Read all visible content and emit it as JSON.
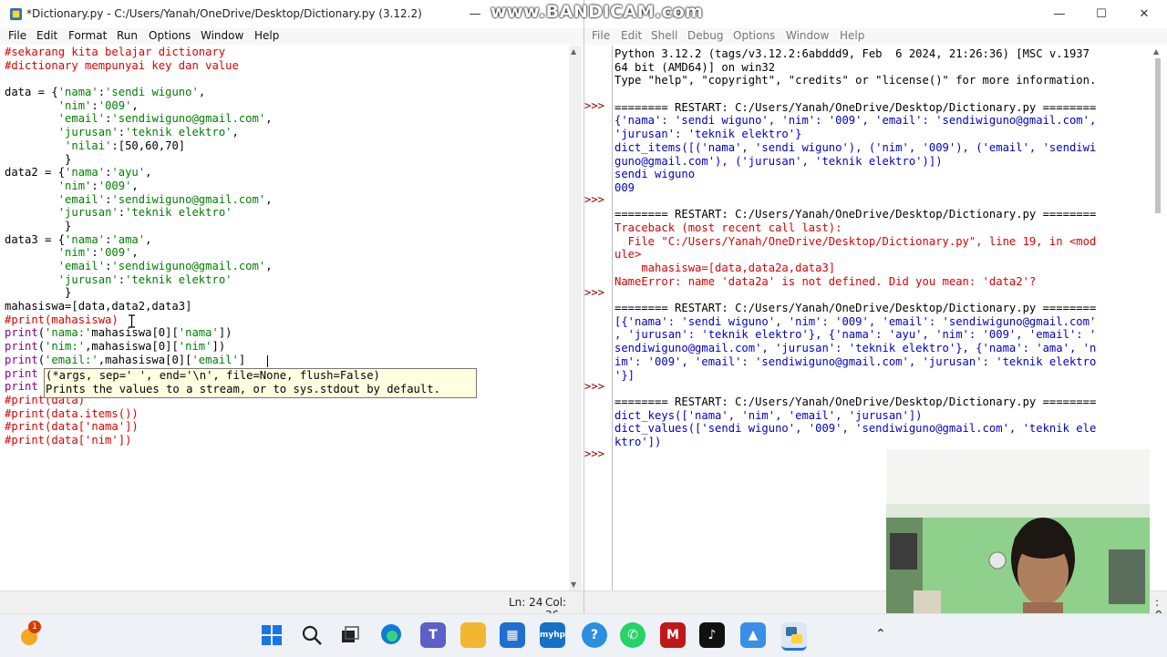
{
  "left_window": {
    "title": "*Dictionary.py - C:/Users/Yanah/OneDrive/Desktop/Dictionary.py (3.12.2)",
    "menu": [
      "File",
      "Edit",
      "Format",
      "Run",
      "Options",
      "Window",
      "Help"
    ],
    "status": {
      "line": "Ln: 24",
      "col": "Col: 36"
    },
    "code": [
      [
        {
          "c": "cm",
          "t": "#sekarang kita belajar dictionary"
        }
      ],
      [
        {
          "c": "cm",
          "t": "#dictionary mempunyai key dan value"
        }
      ],
      [
        {
          "t": ""
        }
      ],
      [
        {
          "t": "data = {"
        },
        {
          "c": "st",
          "t": "'nama'"
        },
        {
          "t": ":"
        },
        {
          "c": "st",
          "t": "'sendi wiguno'"
        },
        {
          "t": ","
        }
      ],
      [
        {
          "t": "        "
        },
        {
          "c": "st",
          "t": "'nim'"
        },
        {
          "t": ":"
        },
        {
          "c": "st",
          "t": "'009'"
        },
        {
          "t": ","
        }
      ],
      [
        {
          "t": "        "
        },
        {
          "c": "st",
          "t": "'email'"
        },
        {
          "t": ":"
        },
        {
          "c": "st",
          "t": "'sendiwiguno@gmail.com'"
        },
        {
          "t": ","
        }
      ],
      [
        {
          "t": "        "
        },
        {
          "c": "st",
          "t": "'jurusan'"
        },
        {
          "t": ":"
        },
        {
          "c": "st",
          "t": "'teknik elektro'"
        },
        {
          "t": ","
        }
      ],
      [
        {
          "t": "         "
        },
        {
          "c": "st",
          "t": "'nilai'"
        },
        {
          "t": ":[50,60,70]"
        }
      ],
      [
        {
          "t": "         }"
        }
      ],
      [
        {
          "t": "data2 = {"
        },
        {
          "c": "st",
          "t": "'nama'"
        },
        {
          "t": ":"
        },
        {
          "c": "st",
          "t": "'ayu'"
        },
        {
          "t": ","
        }
      ],
      [
        {
          "t": "        "
        },
        {
          "c": "st",
          "t": "'nim'"
        },
        {
          "t": ":"
        },
        {
          "c": "st",
          "t": "'009'"
        },
        {
          "t": ","
        }
      ],
      [
        {
          "t": "        "
        },
        {
          "c": "st",
          "t": "'email'"
        },
        {
          "t": ":"
        },
        {
          "c": "st",
          "t": "'sendiwiguno@gmail.com'"
        },
        {
          "t": ","
        }
      ],
      [
        {
          "t": "        "
        },
        {
          "c": "st",
          "t": "'jurusan'"
        },
        {
          "t": ":"
        },
        {
          "c": "st",
          "t": "'teknik elektro'"
        }
      ],
      [
        {
          "t": "         }"
        }
      ],
      [
        {
          "t": "data3 = {"
        },
        {
          "c": "st",
          "t": "'nama'"
        },
        {
          "t": ":"
        },
        {
          "c": "st",
          "t": "'ama'"
        },
        {
          "t": ","
        }
      ],
      [
        {
          "t": "        "
        },
        {
          "c": "st",
          "t": "'nim'"
        },
        {
          "t": ":"
        },
        {
          "c": "st",
          "t": "'009'"
        },
        {
          "t": ","
        }
      ],
      [
        {
          "t": "        "
        },
        {
          "c": "st",
          "t": "'email'"
        },
        {
          "t": ":"
        },
        {
          "c": "st",
          "t": "'sendiwiguno@gmail.com'"
        },
        {
          "t": ","
        }
      ],
      [
        {
          "t": "        "
        },
        {
          "c": "st",
          "t": "'jurusan'"
        },
        {
          "t": ":"
        },
        {
          "c": "st",
          "t": "'teknik elektro'"
        }
      ],
      [
        {
          "t": "         }"
        }
      ],
      [
        {
          "t": "mahasiswa=[data,data2,data3]"
        }
      ],
      [
        {
          "c": "cm",
          "t": "#print(mahasiswa)"
        }
      ],
      [
        {
          "c": "kw",
          "t": "print"
        },
        {
          "t": "("
        },
        {
          "c": "st",
          "t": "'nama:'"
        },
        {
          "t": "mahasiswa[0]["
        },
        {
          "c": "st",
          "t": "'nama'"
        },
        {
          "t": "])"
        }
      ],
      [
        {
          "c": "kw",
          "t": "print"
        },
        {
          "t": "("
        },
        {
          "c": "st",
          "t": "'nim:'"
        },
        {
          "t": ",mahasiswa[0]["
        },
        {
          "c": "st",
          "t": "'nim'"
        },
        {
          "t": "])"
        }
      ],
      [
        {
          "c": "kw",
          "t": "print"
        },
        {
          "t": "("
        },
        {
          "c": "st",
          "t": "'email:'"
        },
        {
          "t": ",mahasiswa[0]["
        },
        {
          "c": "st",
          "t": "'email'"
        },
        {
          "t": "]"
        }
      ],
      [
        {
          "c": "kw",
          "t": "print"
        }
      ],
      [
        {
          "c": "kw",
          "t": "print"
        }
      ],
      [
        {
          "c": "cm",
          "t": "#print(data)"
        }
      ],
      [
        {
          "c": "cm",
          "t": "#print(data.items())"
        }
      ],
      [
        {
          "c": "cm",
          "t": "#print(data['nama'])"
        }
      ],
      [
        {
          "c": "cm",
          "t": "#print(data['nim'])"
        }
      ]
    ],
    "tooltip": {
      "line1": "(*args, sep=' ', end='\\n', file=None, flush=False)",
      "line2": "Prints the values to a stream, or to sys.stdout by default."
    }
  },
  "right_window": {
    "title_tail": "2.2",
    "menu": [
      "File",
      "Edit",
      "Shell",
      "Debug",
      "Options",
      "Window",
      "Help"
    ],
    "status_tail": ": 0",
    "shell": [
      {
        "c": "",
        "t": "Python 3.12.2 (tags/v3.12.2:6abddd9, Feb  6 2024, 21:26:36) [MSC v.1937"
      },
      {
        "c": "",
        "t": "64 bit (AMD64)] on win32"
      },
      {
        "c": "",
        "t": "Type \"help\", \"copyright\", \"credits\" or \"license()\" for more information."
      },
      {
        "c": "",
        "t": ""
      },
      {
        "c": "",
        "t": "======== RESTART: C:/Users/Yanah/OneDrive/Desktop/Dictionary.py ========"
      },
      {
        "c": "out",
        "t": "{'nama': 'sendi wiguno', 'nim': '009', 'email': 'sendiwiguno@gmail.com',"
      },
      {
        "c": "out",
        "t": "'jurusan': 'teknik elektro'}"
      },
      {
        "c": "out",
        "t": "dict_items([('nama', 'sendi wiguno'), ('nim', '009'), ('email', 'sendiwi"
      },
      {
        "c": "out",
        "t": "guno@gmail.com'), ('jurusan', 'teknik elektro')])"
      },
      {
        "c": "out",
        "t": "sendi wiguno"
      },
      {
        "c": "out",
        "t": "009"
      },
      {
        "c": "",
        "t": ""
      },
      {
        "c": "",
        "t": "======== RESTART: C:/Users/Yanah/OneDrive/Desktop/Dictionary.py ========"
      },
      {
        "c": "err",
        "t": "Traceback (most recent call last):"
      },
      {
        "c": "err",
        "t": "  File \"C:/Users/Yanah/OneDrive/Desktop/Dictionary.py\", line 19, in <mod"
      },
      {
        "c": "err",
        "t": "ule>"
      },
      {
        "c": "err",
        "t": "    mahasiswa=[data,data2a,data3]"
      },
      {
        "c": "err",
        "t": "NameError: name 'data2a' is not defined. Did you mean: 'data2'?"
      },
      {
        "c": "",
        "t": ""
      },
      {
        "c": "",
        "t": "======== RESTART: C:/Users/Yanah/OneDrive/Desktop/Dictionary.py ========"
      },
      {
        "c": "out",
        "t": "[{'nama': 'sendi wiguno', 'nim': '009', 'email': 'sendiwiguno@gmail.com'"
      },
      {
        "c": "out",
        "t": ", 'jurusan': 'teknik elektro'}, {'nama': 'ayu', 'nim': '009', 'email': '"
      },
      {
        "c": "out",
        "t": "sendiwiguno@gmail.com', 'jurusan': 'teknik elektro'}, {'nama': 'ama', 'n"
      },
      {
        "c": "out",
        "t": "im': '009', 'email': 'sendiwiguno@gmail.com', 'jurusan': 'teknik elektro"
      },
      {
        "c": "out",
        "t": "'}]"
      },
      {
        "c": "",
        "t": ""
      },
      {
        "c": "",
        "t": "======== RESTART: C:/Users/Yanah/OneDrive/Desktop/Dictionary.py ========"
      },
      {
        "c": "out",
        "t": "dict_keys(['nama', 'nim', 'email', 'jurusan'])"
      },
      {
        "c": "out",
        "t": "dict_values(['sendi wiguno', '009', 'sendiwiguno@gmail.com', 'teknik ele"
      },
      {
        "c": "out",
        "t": "ktro'])"
      },
      {
        "c": "",
        "t": ""
      }
    ],
    "prompt_rows": [
      4,
      11,
      18,
      25,
      30
    ],
    "prompt_text": ">>>"
  },
  "watermark": {
    "text": "www.BANDICAM.com"
  },
  "taskbar": {
    "notification_count": "1",
    "icons": [
      "windows-start-icon",
      "search-icon",
      "task-view-icon",
      "edge-icon",
      "teams-icon",
      "file-explorer-icon",
      "microsoft-store-icon",
      "myhp-icon",
      "help-icon",
      "whatsapp-icon",
      "mcafee-icon",
      "tiktok-icon",
      "photos-icon",
      "python-idle-icon"
    ],
    "myhp_label": "myhp",
    "mcafee_label": "M"
  },
  "colors": {
    "comment": "#dd0000",
    "string": "#008000",
    "keyword": "#900090",
    "output": "#0000cc",
    "prompt": "#8b0000"
  }
}
